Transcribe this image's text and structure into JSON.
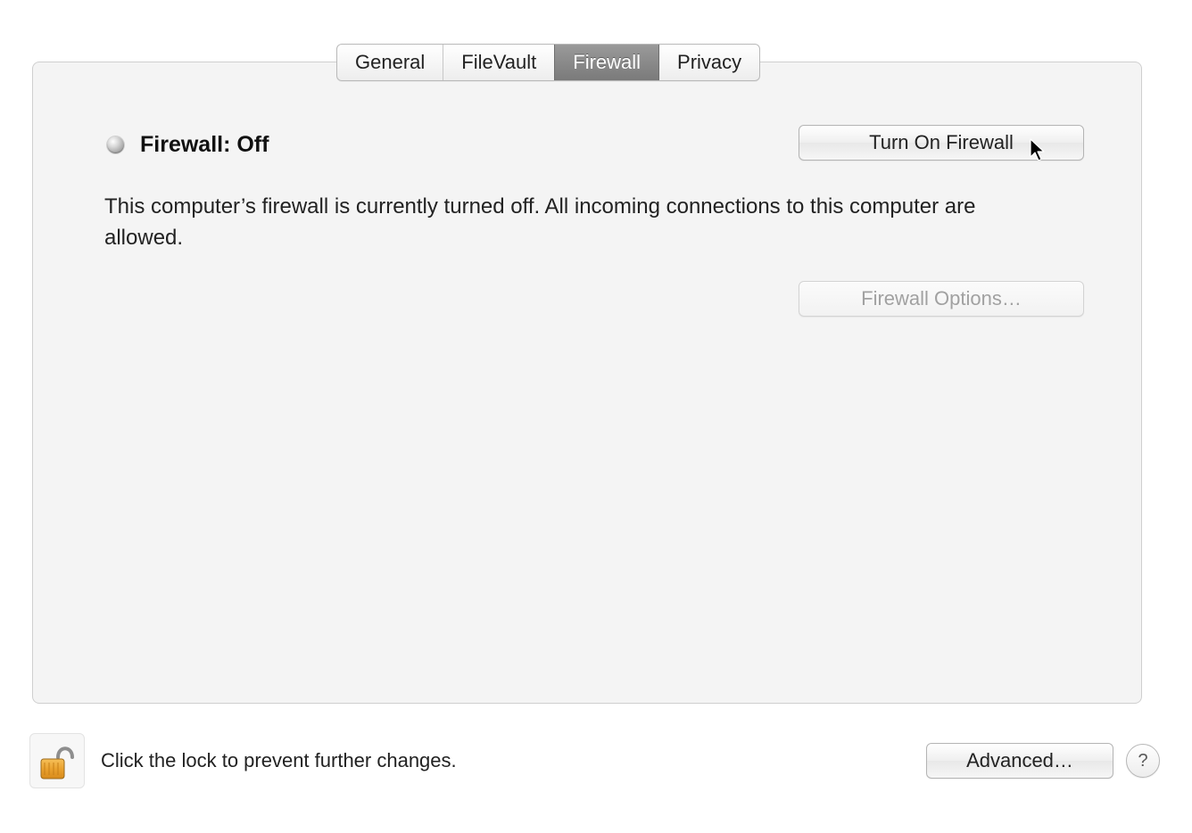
{
  "tabs": {
    "general": "General",
    "filevault": "FileVault",
    "firewall": "Firewall",
    "privacy": "Privacy",
    "active": "firewall"
  },
  "firewall": {
    "status_title": "Firewall: Off",
    "turn_on_label": "Turn On Firewall",
    "description": "This computer’s firewall is currently turned off. All incoming connections to this computer are allowed.",
    "options_label": "Firewall Options…",
    "options_enabled": false
  },
  "footer": {
    "lock_text": "Click the lock to prevent further changes.",
    "advanced_label": "Advanced…",
    "help_label": "?"
  }
}
